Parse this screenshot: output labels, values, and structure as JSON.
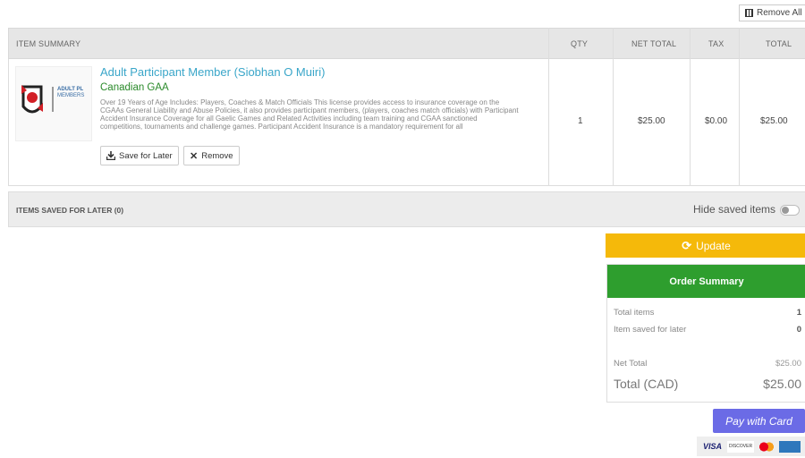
{
  "actions": {
    "remove_all": "Remove All"
  },
  "table": {
    "headers": {
      "item": "ITEM SUMMARY",
      "qty": "QTY",
      "net": "NET TOTAL",
      "tax": "TAX",
      "total": "TOTAL"
    },
    "rows": [
      {
        "title": "Adult Participant Member (Siobhan O Muiri)",
        "org": "Canadian GAA",
        "thumb_text": [
          "ADULT PL",
          "MEMBERS"
        ],
        "description": "Over 19 Years of Age Includes: Players, Coaches & Match Officials This license provides access to insurance coverage on the CGAAs General Liability and Abuse Policies, it also provides participant members, (players, coaches match officials) with Participant Accident Insurance Coverage for all Gaelic Games and Related Activities including team training and CGAA sanctioned competitions, tournaments and challenge games. Participant Accident Insurance is a mandatory requirement for all",
        "save_label": "Save for Later",
        "remove_label": "Remove",
        "qty": "1",
        "net": "$25.00",
        "tax": "$0.00",
        "total": "$25.00"
      }
    ]
  },
  "saved": {
    "title": "ITEMS SAVED FOR LATER (0)",
    "hide_label": "Hide saved items"
  },
  "update_label": "Update",
  "summary": {
    "title": "Order Summary",
    "total_items_label": "Total items",
    "total_items": "1",
    "saved_label": "Item saved for later",
    "saved": "0",
    "net_label": "Net Total",
    "net": "$25.00",
    "total_label": "Total (CAD)",
    "total": "$25.00"
  },
  "pay_label": "Pay with Card",
  "card_logos": [
    "VISA",
    "DISCOVER",
    "mastercard",
    "AMERICAN EXPRESS"
  ],
  "colors": {
    "accent_green": "#2e9e2e",
    "update_yellow": "#f5b90a",
    "pay_purple": "#6b6be6",
    "link_blue": "#3aa6c9"
  }
}
